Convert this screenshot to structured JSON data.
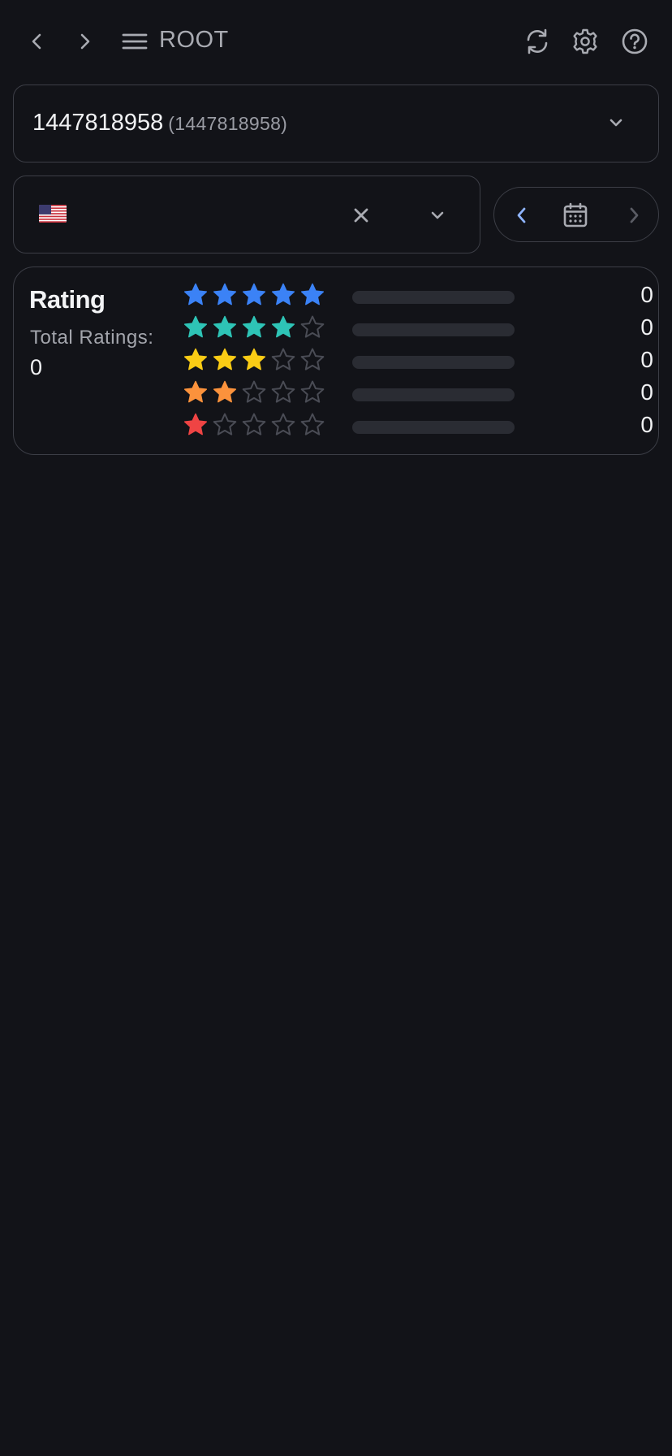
{
  "header": {
    "title": "ROOT",
    "icons": [
      "chevron-left-icon",
      "chevron-right-icon",
      "menu-icon",
      "refresh-icon",
      "gear-icon",
      "help-icon"
    ]
  },
  "app_selector": {
    "name": "1447818958",
    "id_label": "(1447818958)"
  },
  "country_selector": {
    "flag": "us-flag-icon",
    "value": ""
  },
  "date_nav": {
    "prev_color": "#8fb4ff",
    "next_color": "#5a5c64"
  },
  "rating": {
    "title": "Rating",
    "total_label": "Total Ratings:",
    "total_value": "0",
    "rows": [
      {
        "stars": 5,
        "color": "#3b82f6",
        "count": "0",
        "fraction": 0
      },
      {
        "stars": 4,
        "color": "#2ec4b6",
        "count": "0",
        "fraction": 0
      },
      {
        "stars": 3,
        "color": "#facc15",
        "count": "0",
        "fraction": 0
      },
      {
        "stars": 2,
        "color": "#fb923c",
        "count": "0",
        "fraction": 0
      },
      {
        "stars": 1,
        "color": "#ef4444",
        "count": "0",
        "fraction": 0
      }
    ]
  }
}
